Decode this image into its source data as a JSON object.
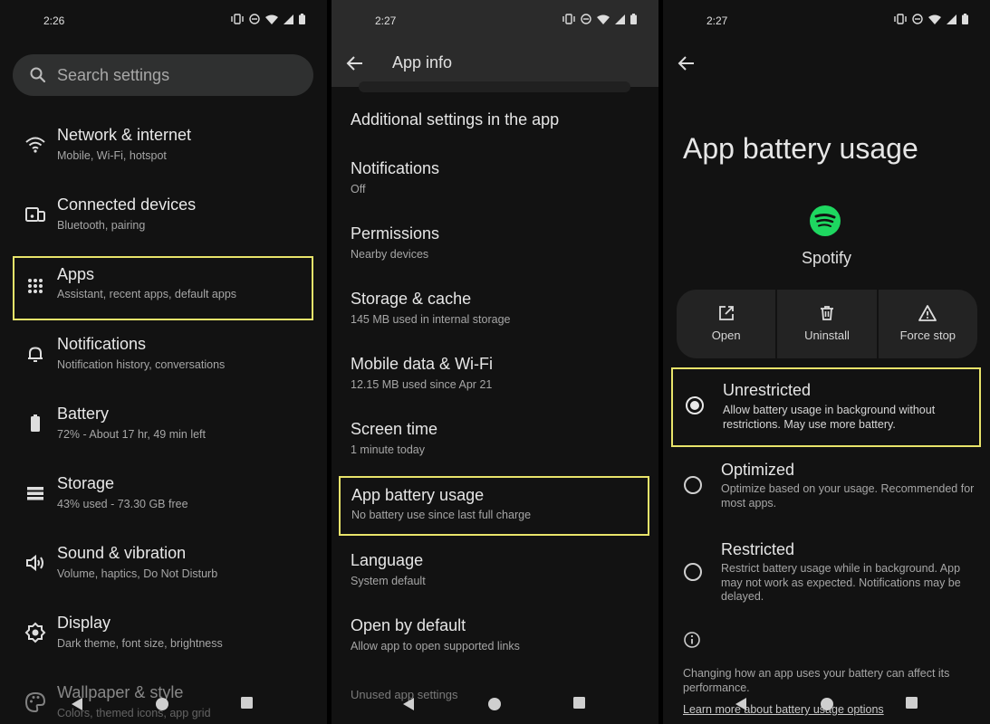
{
  "panel1": {
    "status": {
      "time": "2:26"
    },
    "search": {
      "placeholder": "Search settings"
    },
    "items": [
      {
        "title": "Network & internet",
        "subtitle": "Mobile, Wi-Fi, hotspot",
        "icon": "wifi-icon"
      },
      {
        "title": "Connected devices",
        "subtitle": "Bluetooth, pairing",
        "icon": "devices-icon"
      },
      {
        "title": "Apps",
        "subtitle": "Assistant, recent apps, default apps",
        "icon": "apps-grid-icon"
      },
      {
        "title": "Notifications",
        "subtitle": "Notification history, conversations",
        "icon": "bell-icon"
      },
      {
        "title": "Battery",
        "subtitle": "72% - About 17 hr, 49 min left",
        "icon": "battery-icon"
      },
      {
        "title": "Storage",
        "subtitle": "43% used - 73.30 GB free",
        "icon": "storage-icon"
      },
      {
        "title": "Sound & vibration",
        "subtitle": "Volume, haptics, Do Not Disturb",
        "icon": "volume-icon"
      },
      {
        "title": "Display",
        "subtitle": "Dark theme, font size, brightness",
        "icon": "brightness-icon"
      },
      {
        "title": "Wallpaper & style",
        "subtitle": "Colors, themed icons, app grid",
        "icon": "palette-icon"
      }
    ]
  },
  "panel2": {
    "status": {
      "time": "2:27"
    },
    "header": {
      "title": "App info"
    },
    "items": [
      {
        "title": "Additional settings in the app",
        "subtitle": ""
      },
      {
        "title": "Notifications",
        "subtitle": "Off"
      },
      {
        "title": "Permissions",
        "subtitle": "Nearby devices"
      },
      {
        "title": "Storage & cache",
        "subtitle": "145 MB used in internal storage"
      },
      {
        "title": "Mobile data & Wi-Fi",
        "subtitle": "12.15 MB used since Apr 21"
      },
      {
        "title": "Screen time",
        "subtitle": "1 minute today"
      },
      {
        "title": "App battery usage",
        "subtitle": "No battery use since last full charge"
      },
      {
        "title": "Language",
        "subtitle": "System default"
      },
      {
        "title": "Open by default",
        "subtitle": "Allow app to open supported links"
      },
      {
        "title": "Unused app settings",
        "subtitle": ""
      }
    ]
  },
  "panel3": {
    "status": {
      "time": "2:27"
    },
    "title": "App battery usage",
    "app": {
      "name": "Spotify",
      "brand_color": "#1ed760"
    },
    "actions": [
      {
        "label": "Open",
        "icon": "open-external-icon"
      },
      {
        "label": "Uninstall",
        "icon": "trash-icon"
      },
      {
        "label": "Force stop",
        "icon": "warning-icon"
      }
    ],
    "options": [
      {
        "title": "Unrestricted",
        "desc": "Allow battery usage in background without restrictions. May use more battery.",
        "selected": true
      },
      {
        "title": "Optimized",
        "desc": "Optimize based on your usage. Recommended for most apps.",
        "selected": false
      },
      {
        "title": "Restricted",
        "desc": "Restrict battery usage while in background. App may not work as expected. Notifications may be delayed.",
        "selected": false
      }
    ],
    "footnote": "Changing how an app uses your battery can affect its performance.",
    "learn_more": "Learn more about battery usage options"
  },
  "colors": {
    "highlight": "#e8e36a",
    "background": "#121212",
    "header": "#2b2b2b"
  }
}
